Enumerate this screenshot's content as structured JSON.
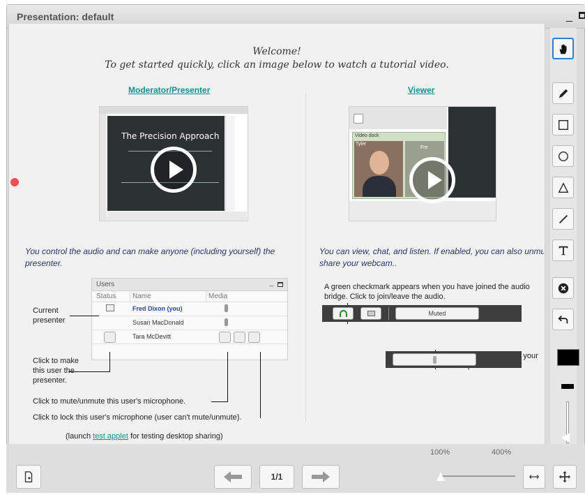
{
  "window": {
    "title": "Presentation: default",
    "minimize_glyph": "_"
  },
  "slide": {
    "welcome_line1": "Welcome!",
    "welcome_line2": "To get started quickly, click an image below to watch a tutorial video.",
    "moderator": {
      "title": "Moderator/Presenter",
      "video_title": "The Precision Approach",
      "description": "You control the audio and can make anyone (including yourself) the presenter."
    },
    "viewer": {
      "title": "Viewer",
      "description": "You can view, chat, and listen.  If enabled, you can also unmute and share your webcam..",
      "video_dock_label": "Video dock",
      "webcam_names": [
        "Tyler",
        "Fre"
      ]
    },
    "users_panel": {
      "title": "Users",
      "columns": [
        "Status",
        "Name",
        "Media"
      ],
      "rows": [
        {
          "name": "Fred Dixon (you)",
          "presenter": true
        },
        {
          "name": "Susan MacDonald",
          "presenter": false
        },
        {
          "name": "Tara McDevitt",
          "presenter": false
        }
      ]
    },
    "notes": {
      "current_presenter": "Current presenter",
      "make_presenter": "Click to make this user the presenter.",
      "mute_user": "Click to mute/unmute this user's microphone.",
      "lock_user": "Click to lock this user's microphone (user can't mute/unmute).",
      "green_check": "A green checkmark appears when you have joined the audio bridge.  Click to join/leave the audio.",
      "mute_self": "Click to mute/unmute your microphone."
    },
    "audio": {
      "muted_label": "Muted"
    },
    "launch_prefix": "(launch ",
    "launch_link": "test applet",
    "launch_suffix": " for testing desktop sharing)"
  },
  "toolbar": {
    "tools": [
      "hand-icon",
      "pencil-icon",
      "rectangle-icon",
      "ellipse-icon",
      "triangle-icon",
      "line-icon",
      "text-icon",
      "clear-icon",
      "undo-icon"
    ],
    "color": "#000000"
  },
  "bottom": {
    "page_indicator": "1/1",
    "zoom_min": "100%",
    "zoom_max": "400%",
    "zoom_level": 0
  },
  "colors": {
    "link": "#0f8f8f",
    "description": "#27356b",
    "active_tool_border": "#2b7fd0",
    "pointer_dot": "#ef4d58"
  }
}
